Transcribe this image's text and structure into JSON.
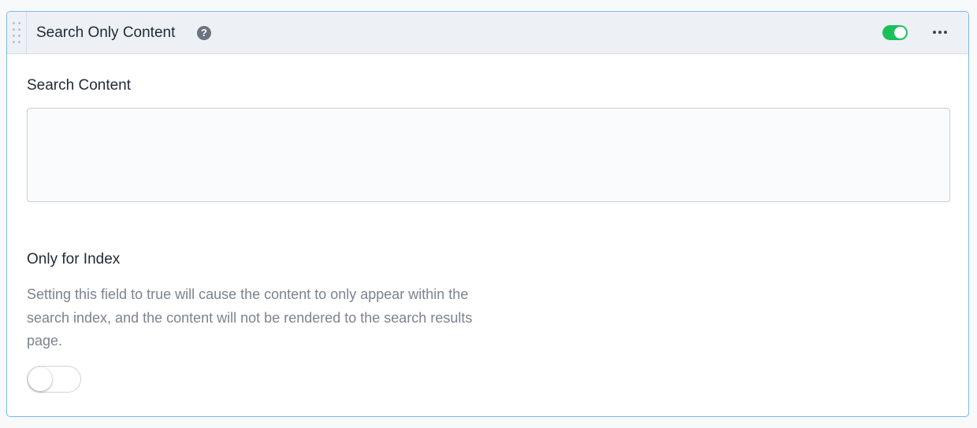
{
  "block": {
    "title": "Search Only Content",
    "help_icon": "question-circle-icon",
    "enabled_toggle": {
      "on": true,
      "color": "#1dbf5c"
    },
    "menu_icon": "more-horizontal-icon",
    "drag_icon": "drag-handle-icon"
  },
  "fields": {
    "search_content": {
      "label": "Search Content",
      "value": "",
      "placeholder": ""
    },
    "only_for_index": {
      "label": "Only for Index",
      "description": "Setting this field to true will cause the content to only appear within the search index, and the content will not be rendered to the search results page.",
      "value": false
    }
  }
}
